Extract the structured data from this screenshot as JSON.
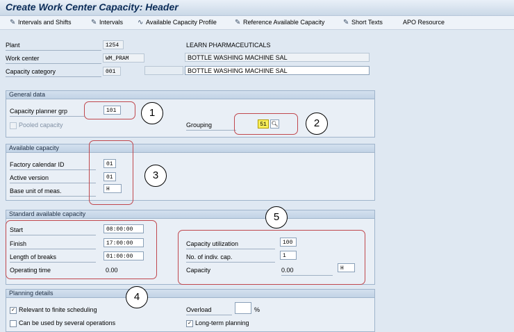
{
  "header": {
    "title": "Create Work Center Capacity: Header"
  },
  "toolbar": {
    "intervals_shifts": "Intervals and Shifts",
    "intervals": "Intervals",
    "avail_cap_profile": "Available Capacity Profile",
    "ref_avail_cap": "Reference Available Capacity",
    "short_texts": "Short Texts",
    "apo_resource": "APO Resource"
  },
  "top": {
    "plant_label": "Plant",
    "plant_value": "1254",
    "plant_desc": "LEARN PHARMACEUTICALS",
    "wc_label": "Work center",
    "wc_value": "WM_PRAM",
    "wc_desc": "BOTTLE WASHING MACHINE SAL",
    "cc_label": "Capacity category",
    "cc_value": "001",
    "cc_desc": "BOTTLE WASHING MACHINE SAL"
  },
  "general": {
    "title": "General data",
    "planner_label": "Capacity planner grp",
    "planner_value": "101",
    "pooled_label": "Pooled capacity",
    "grouping_label": "Grouping",
    "grouping_value": "51"
  },
  "available": {
    "title": "Available capacity",
    "factory_label": "Factory calendar ID",
    "factory_value": "01",
    "version_label": "Active version",
    "version_value": "01",
    "uom_label": "Base unit of meas.",
    "uom_value": "H"
  },
  "standard": {
    "title": "Standard available capacity",
    "start_label": "Start",
    "start_value": "08:00:00",
    "finish_label": "Finish",
    "finish_value": "17:00:00",
    "breaks_label": "Length of breaks",
    "breaks_value": "01:00:00",
    "optime_label": "Operating time",
    "optime_value": "0.00",
    "util_label": "Capacity utilization",
    "util_value": "100",
    "indiv_label": "No. of indiv. cap.",
    "indiv_value": "1",
    "capacity_label": "Capacity",
    "capacity_value": "0.00",
    "capacity_unit": "H"
  },
  "planning": {
    "title": "Planning details",
    "finite_label": "Relevant to finite scheduling",
    "several_label": "Can be used by several operations",
    "overload_label": "Overload",
    "overload_unit": "%",
    "longterm_label": "Long-term planning"
  },
  "markers": {
    "m1": "1",
    "m2": "2",
    "m3": "3",
    "m4": "4",
    "m5": "5"
  },
  "colors": {
    "annotation_ring": "#c0474d",
    "highlight": "#f7ee5a"
  }
}
